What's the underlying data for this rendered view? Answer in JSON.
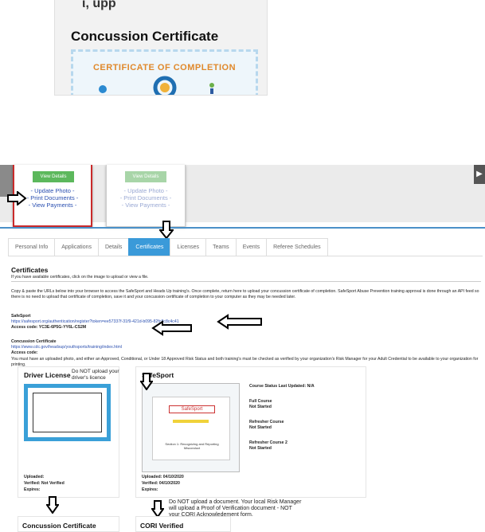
{
  "top_crop": {
    "partial_text": "ι, upp",
    "title": "Concussion Certificate",
    "certificate_banner": "CERTIFICATE OF COMPLETION"
  },
  "cards": [
    {
      "view_details": "View Details",
      "links": [
        "- Update Photo -",
        "- Print Documents -",
        "- View Payments -"
      ]
    },
    {
      "view_details": "View Details",
      "links": [
        "- Update Photo -",
        "- Print Documents -",
        "- View Payments -"
      ]
    }
  ],
  "tabs": [
    {
      "label": "Personal Info"
    },
    {
      "label": "Applications"
    },
    {
      "label": "Details"
    },
    {
      "label": "Certificates"
    },
    {
      "label": "Licenses"
    },
    {
      "label": "Teams"
    },
    {
      "label": "Events"
    },
    {
      "label": "Referee Schedules"
    }
  ],
  "certificates": {
    "heading": "Certificates",
    "subheading": "If you have available certificates, click on the image to upload or view a file.",
    "instructions": "Copy & paste the URLs below into your browser to access the SafeSport and Heads Up training's. Once complete, return here to upload your concussion certificate of completion. SafeSport Abuse Prevention training approval is done through an API feed so there is no need to upload that certificate of completion, save it and your concussion certificate of completion to your computer as they may be needed later.",
    "safesport_label": "SafeSport",
    "safesport_url": "https://safesport.org/authentication/register?token=ee57337f-31f9-421d-b095-82fc8c8c4c41",
    "safesport_access": "Access code: YC3E-6P5G-YY6L-CS2M",
    "concussion_label": "Concussion Certificate",
    "concussion_url": "https://www.cdc.gov/headsup/youthsports/training/index.html",
    "concussion_access": "Access code:",
    "requirement": "You must have an uploaded photo, and either an Approved, Conditional, or Under 18 Approved Risk Status and both training's must be checked as verified by your organization's Risk Manager for your Adult Credential to be available to your organization for printing."
  },
  "driver_license": {
    "title": "Driver License",
    "note": "Do NOT upload your driver's licence",
    "uploaded": "Uploaded:",
    "verified": "Verified: Not Verified",
    "expires": "Expires:"
  },
  "safesport": {
    "title": "SafeSport",
    "status_updated": "Course Status Last Updated: N/A",
    "full_course_label": "Full Course",
    "full_course_status": "Not Started",
    "refresher_label": "Refresher Course",
    "refresher_status": "Not Started",
    "refresher2_label": "Refresher Course 2",
    "refresher2_status": "Not Started",
    "uploaded": "Uploaded: 04/10/2020",
    "verified": "Verified: 04/10/2020",
    "expires": "Expires:",
    "thumb_brand": "SafeSport",
    "thumb_caption": "Section 1: Recognizing and Reporting Misconduct"
  },
  "cori_note": "Do NOT upload a document. Your local Risk Manager will upload a Proof of Verification document - NOT your CORI Acknowledement form.",
  "bottom": {
    "concussion_title": "Concussion Certificate",
    "cori_title": "CORI Verified"
  },
  "colors": {
    "accent_blue": "#3a9ad9",
    "link_blue": "#2a4fb0",
    "card_border_red": "#c92a2a",
    "button_green": "#5cb85c"
  }
}
